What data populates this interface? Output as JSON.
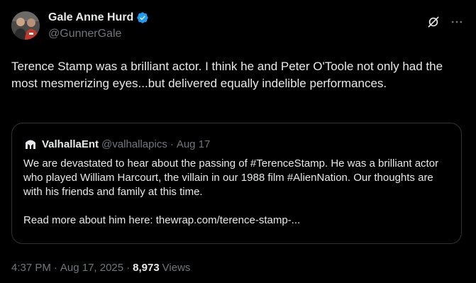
{
  "author": {
    "display_name": "Gale Anne Hurd",
    "handle": "@GunnerGale",
    "verified_color": "#1d9bf0",
    "avatar_icon": "user-avatar-photo"
  },
  "actions": {
    "grok_icon": "grok-icon",
    "more_icon": "more-dots-icon"
  },
  "tweet": {
    "text": "Terence Stamp was a brilliant actor. I think he and Peter O'Toole not only had the most mesmerizing eyes...but delivered equally indelible performances."
  },
  "quote": {
    "display_name": "ValhallaEnt",
    "handle": "@valhallapics",
    "separator": "·",
    "date": "Aug 17",
    "paragraph1": "We are devastated to hear about the passing of #TerenceStamp. He was a brilliant actor who played William Harcourt, the villain in our 1988 film #AlienNation. Our thoughts are with his friends and family at this time.",
    "paragraph2": "Read more about him here: thewrap.com/terence-stamp-..."
  },
  "meta": {
    "time": "4:37 PM",
    "separator": "·",
    "date": "Aug 17, 2025",
    "separator2": "·",
    "views_count": "8,973",
    "views_label": "Views"
  },
  "colors": {
    "background": "#000000",
    "text_primary": "#e7e9ea",
    "text_secondary": "#71767b",
    "border": "#2f3336",
    "accent": "#1d9bf0"
  }
}
